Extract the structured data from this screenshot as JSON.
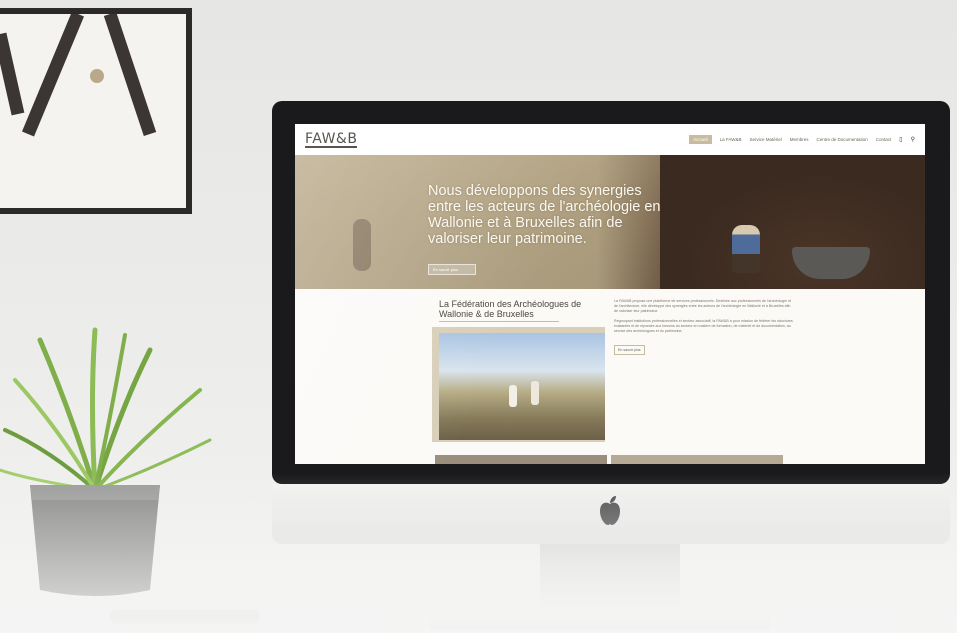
{
  "site": {
    "logo": "FAW&B",
    "nav": [
      {
        "label": "Accueil",
        "active": true
      },
      {
        "label": "La FAW&B",
        "active": false
      },
      {
        "label": "Service Matériel",
        "active": false
      },
      {
        "label": "Membres",
        "active": false
      },
      {
        "label": "Centre de Documentation",
        "active": false
      },
      {
        "label": "Contact",
        "active": false
      }
    ],
    "hero": {
      "headline": "Nous développons des synergies entre les acteurs de l'archéologie en Wallonie et à Bruxelles afin de valoriser leur patrimoine.",
      "button_label": "En savoir plus"
    },
    "section": {
      "title": "La Fédération des Archéologues de Wallonie & de Bruxelles",
      "paragraphs": [
        "La FAW&B propose une plateforme de services professionnels. Destinée aux professionnels de l'archéologie et de l'architecture, elle développe des synergies entre les acteurs de l'archéologie en Wallonie et à Bruxelles afin de valoriser leur patrimoine.",
        "Regroupant institutions professionnelles et secteur associatif, la FAW&B a pour mission de fédérer les structures existantes et de répondre aux besoins du secteur en matière de formation, de matériel et de documentation, au service des archéologues et du patrimoine."
      ],
      "more_label": "En savoir plus"
    }
  },
  "colors": {
    "accent": "#c8bc9f",
    "imac_bezel": "#1a1a1c",
    "page_bg": "#ececea"
  },
  "icons": {
    "nav_extra": "flag-icon",
    "search": "search-icon",
    "device_logo": "apple-logo-icon"
  }
}
